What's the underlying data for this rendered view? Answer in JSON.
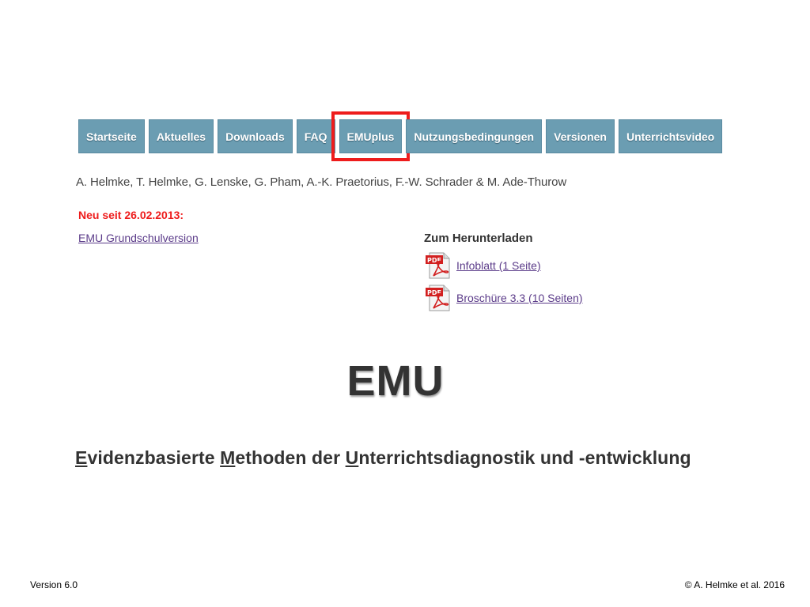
{
  "nav": {
    "items": [
      {
        "label": "Startseite"
      },
      {
        "label": "Aktuelles"
      },
      {
        "label": "Downloads"
      },
      {
        "label": "FAQ"
      },
      {
        "label": "EMUplus"
      },
      {
        "label": "Nutzungsbedingungen"
      },
      {
        "label": "Versionen"
      },
      {
        "label": "Unterrichtsvideo"
      }
    ],
    "highlighted": "EMUplus",
    "color": "#6b9db2",
    "highlight_color": "#ee1c1c"
  },
  "authors": "A. Helmke, T. Helmke, G. Lenske, G. Pham, A.-K. Praetorius, F.-W. Schrader & M. Ade-Thurow",
  "news": {
    "label": "Neu seit 26.02.2013:",
    "link": "EMU Grundschulversion"
  },
  "downloads": {
    "heading": "Zum Herunterladen",
    "items": [
      {
        "icon": "pdf-icon",
        "label": "Infoblatt (1 Seite)"
      },
      {
        "icon": "pdf-icon",
        "label": "Broschüre 3.3 (10 Seiten)"
      }
    ]
  },
  "title": "EMU",
  "subtitle": {
    "parts": [
      {
        "u": "E",
        "rest": "videnzbasierte "
      },
      {
        "u": "M",
        "rest": "ethoden der "
      },
      {
        "u": "U",
        "rest": "nterrichtsdiagnostik und -entwicklung"
      }
    ]
  },
  "footer": {
    "version": "Version 6.0",
    "copyright": "© A. Helmke et al. 2016"
  }
}
